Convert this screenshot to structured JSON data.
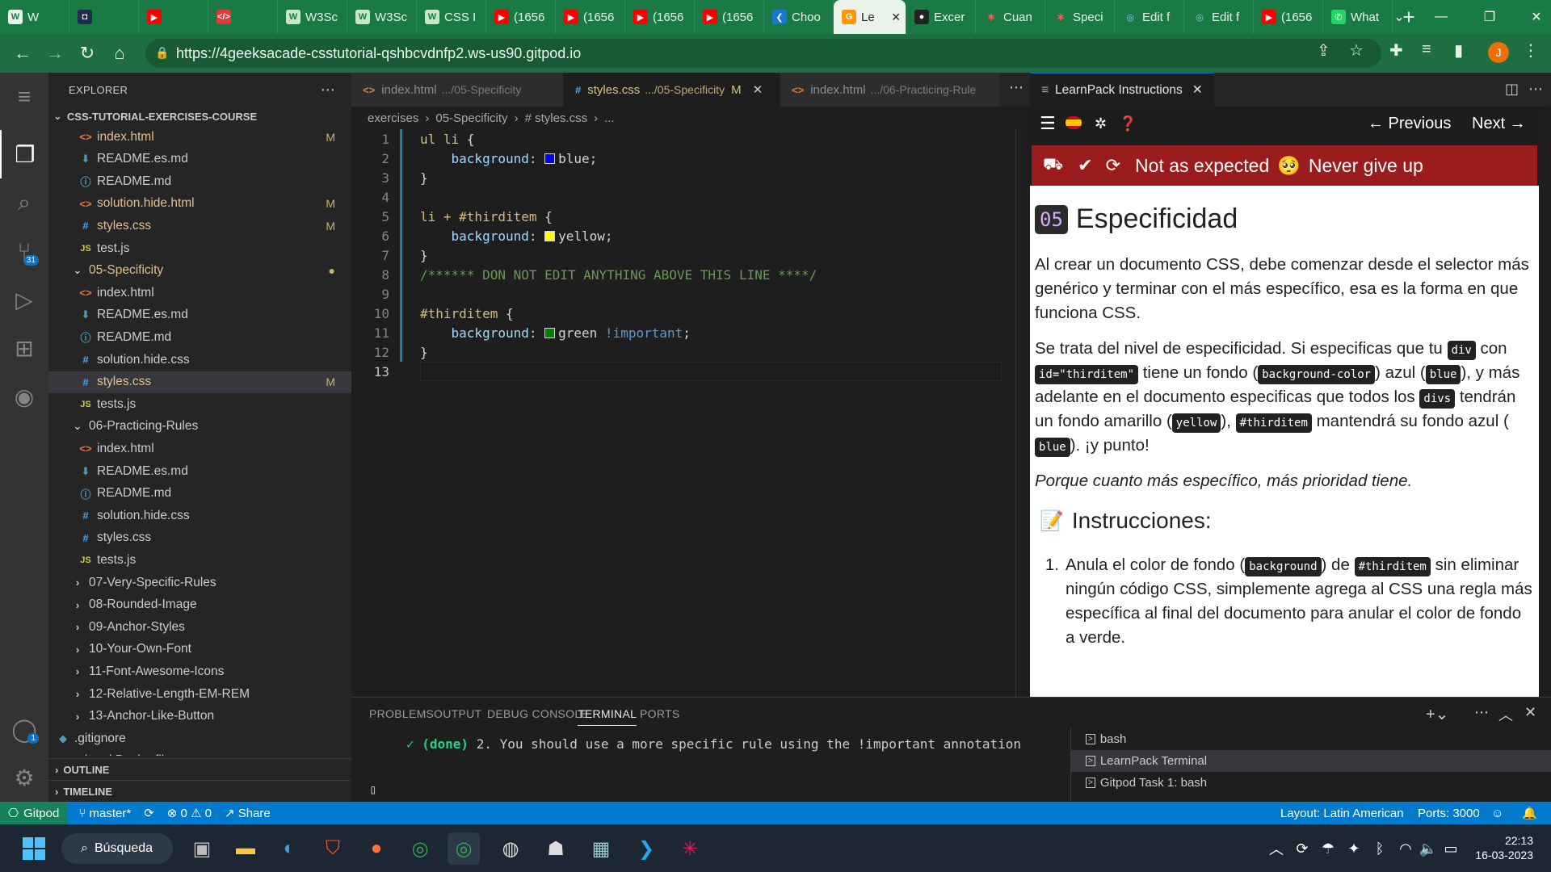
{
  "browser": {
    "tabs": [
      {
        "label": "W",
        "fav": "W",
        "favcolor": "#1a7a45",
        "favbg": "#e6f2ea"
      },
      {
        "label": "",
        "fav": "◘",
        "favcolor": "#fff",
        "favbg": "#1f2d4f"
      },
      {
        "label": "",
        "fav": "▶",
        "favcolor": "#fff",
        "favbg": "#ff0000"
      },
      {
        "label": "",
        "fav": "</>",
        "favcolor": "#fff",
        "favbg": "#e53935"
      },
      {
        "label": "W3Sc",
        "fav": "W",
        "favcolor": "#1a7a45",
        "favbg": "#c8e6c9"
      },
      {
        "label": "W3Sc",
        "fav": "W",
        "favcolor": "#1a7a45",
        "favbg": "#c8e6c9"
      },
      {
        "label": "CSS I",
        "fav": "W",
        "favcolor": "#1a7a45",
        "favbg": "#c8e6c9"
      },
      {
        "label": "(1656",
        "fav": "▶",
        "favcolor": "#fff",
        "favbg": "#ff0000"
      },
      {
        "label": "(1656",
        "fav": "▶",
        "favcolor": "#fff",
        "favbg": "#ff0000"
      },
      {
        "label": "(1656",
        "fav": "▶",
        "favcolor": "#fff",
        "favbg": "#ff0000"
      },
      {
        "label": "(1656",
        "fav": "▶",
        "favcolor": "#fff",
        "favbg": "#ff0000"
      },
      {
        "label": "Choo",
        "fav": "❮",
        "favcolor": "#fff",
        "favbg": "#1976d2"
      },
      {
        "label": "Le",
        "fav": "G",
        "favcolor": "#fff",
        "favbg": "#ff9800",
        "active": true
      },
      {
        "label": "Excer",
        "fav": "●",
        "favcolor": "#fff",
        "favbg": "#222"
      },
      {
        "label": "Cuan",
        "fav": "✱",
        "favcolor": "#ff5252",
        "favbg": "transparent"
      },
      {
        "label": "Speci",
        "fav": "✱",
        "favcolor": "#ff5252",
        "favbg": "transparent"
      },
      {
        "label": "Edit f",
        "fav": "◎",
        "favcolor": "#90caf9",
        "favbg": "transparent"
      },
      {
        "label": "Edit f",
        "fav": "◎",
        "favcolor": "#90caf9",
        "favbg": "transparent"
      },
      {
        "label": "(1656",
        "fav": "▶",
        "favcolor": "#fff",
        "favbg": "#ff0000"
      },
      {
        "label": "What",
        "fav": "✆",
        "favcolor": "#fff",
        "favbg": "#25d366"
      }
    ],
    "new_tab": "+",
    "url": "https://4geeksacade-csstutorial-qshbcvdnfp2.ws-us90.gitpod.io",
    "profile_initial": "J"
  },
  "explorer": {
    "title": "EXPLORER",
    "root": "CSS-TUTORIAL-EXERCISES-COURSE",
    "items": [
      {
        "label": "index.html",
        "type": "html",
        "indent": 1,
        "mark": "M",
        "yellow": true
      },
      {
        "label": "README.es.md",
        "type": "md",
        "indent": 1
      },
      {
        "label": "README.md",
        "type": "info",
        "indent": 1
      },
      {
        "label": "solution.hide.html",
        "type": "html",
        "indent": 1,
        "mark": "M",
        "yellow": true
      },
      {
        "label": "styles.css",
        "type": "css",
        "indent": 1,
        "mark": "M",
        "yellow": true
      },
      {
        "label": "test.js",
        "type": "js",
        "indent": 1
      },
      {
        "label": "05-Specificity",
        "type": "folder-open",
        "indent": 0,
        "mark": "●",
        "yellow": true
      },
      {
        "label": "index.html",
        "type": "html",
        "indent": 1
      },
      {
        "label": "README.es.md",
        "type": "md",
        "indent": 1
      },
      {
        "label": "README.md",
        "type": "info",
        "indent": 1
      },
      {
        "label": "solution.hide.css",
        "type": "css",
        "indent": 1
      },
      {
        "label": "styles.css",
        "type": "css",
        "indent": 1,
        "mark": "M",
        "yellow": true,
        "selected": true
      },
      {
        "label": "tests.js",
        "type": "js",
        "indent": 1
      },
      {
        "label": "06-Practicing-Rules",
        "type": "folder-open",
        "indent": 0
      },
      {
        "label": "index.html",
        "type": "html",
        "indent": 1
      },
      {
        "label": "README.es.md",
        "type": "md",
        "indent": 1
      },
      {
        "label": "README.md",
        "type": "info",
        "indent": 1
      },
      {
        "label": "solution.hide.css",
        "type": "css",
        "indent": 1
      },
      {
        "label": "styles.css",
        "type": "css",
        "indent": 1
      },
      {
        "label": "tests.js",
        "type": "js",
        "indent": 1
      },
      {
        "label": "07-Very-Specific-Rules",
        "type": "folder",
        "indent": 0
      },
      {
        "label": "08-Rounded-Image",
        "type": "folder",
        "indent": 0
      },
      {
        "label": "09-Anchor-Styles",
        "type": "folder",
        "indent": 0
      },
      {
        "label": "10-Your-Own-Font",
        "type": "folder",
        "indent": 0
      },
      {
        "label": "11-Font-Awesome-Icons",
        "type": "folder",
        "indent": 0
      },
      {
        "label": "12-Relative-Length-EM-REM",
        "type": "folder",
        "indent": 0
      },
      {
        "label": "13-Anchor-Like-Button",
        "type": "folder",
        "indent": 0
      },
      {
        "label": ".gitignore",
        "type": "git",
        "indent": -1
      },
      {
        "label": ".gitpod.Dockerfile",
        "type": "docker",
        "indent": -1
      }
    ],
    "outline": "OUTLINE",
    "timeline": "TIMELINE"
  },
  "editor": {
    "tabs": [
      {
        "label": "index.html",
        "path": ".../05-Specificity",
        "icon": "<>"
      },
      {
        "label": "styles.css",
        "path": ".../05-Specificity",
        "icon": "#",
        "active": true,
        "mark": "M"
      },
      {
        "label": "index.html",
        "path": ".../06-Practicing-Rule",
        "icon": "<>"
      }
    ],
    "breadcrumb": [
      "exercises",
      "05-Specificity",
      "# styles.css",
      "..."
    ],
    "lines": [
      [
        {
          "t": "ul li ",
          "c": "sel-tok"
        },
        {
          "t": "{",
          "c": "val-tok"
        }
      ],
      [
        {
          "t": "    background",
          "c": "prop-tok"
        },
        {
          "t": ": ",
          "c": "val-tok"
        },
        {
          "t": "",
          "c": "swatch",
          "color": "#0000ff"
        },
        {
          "t": "blue;",
          "c": "val-tok"
        }
      ],
      [
        {
          "t": "}",
          "c": "val-tok"
        }
      ],
      [],
      [
        {
          "t": "li + #thirditem ",
          "c": "sel-tok"
        },
        {
          "t": "{",
          "c": "val-tok"
        }
      ],
      [
        {
          "t": "    background",
          "c": "prop-tok"
        },
        {
          "t": ": ",
          "c": "val-tok"
        },
        {
          "t": "",
          "c": "swatch",
          "color": "#ffff00"
        },
        {
          "t": "yellow;",
          "c": "val-tok"
        }
      ],
      [
        {
          "t": "}",
          "c": "val-tok"
        }
      ],
      [
        {
          "t": "/****** DON NOT EDIT ANYTHING ABOVE THIS LINE ****/",
          "c": "com-tok"
        }
      ],
      [],
      [
        {
          "t": "#thirditem ",
          "c": "sel-tok"
        },
        {
          "t": "{",
          "c": "val-tok"
        }
      ],
      [
        {
          "t": "    background",
          "c": "prop-tok"
        },
        {
          "t": ": ",
          "c": "val-tok"
        },
        {
          "t": "",
          "c": "swatch",
          "color": "#008000"
        },
        {
          "t": "green ",
          "c": "val-tok"
        },
        {
          "t": "!important",
          "c": "imp-tok"
        },
        {
          "t": ";",
          "c": "val-tok"
        }
      ],
      [
        {
          "t": "}",
          "c": "val-tok"
        }
      ],
      []
    ]
  },
  "panel": {
    "tabs": [
      "PROBLEMS",
      "OUTPUT",
      "DEBUG CONSOLE",
      "TERMINAL",
      "PORTS"
    ],
    "active_tab": "TERMINAL",
    "output_done": "✓ (done)",
    "output_text": "2. You should use a more specific rule using the !important annotation",
    "cursor": "▯",
    "terminals": [
      "bash",
      "LearnPack Terminal",
      "Gitpod Task 1: bash"
    ]
  },
  "learnpack": {
    "tab_title": "LearnPack Instructions",
    "prev": "← Previous",
    "next": "Next →",
    "status_text": "Not as expected",
    "status_emoji": "🥺",
    "status_tail": "Never give up",
    "step": "05",
    "title": "Especificidad",
    "p1": "Al crear un documento CSS, debe comenzar desde el selector más genérico y terminar con el más específico, esa es la forma en que funciona CSS.",
    "p2": {
      "a": "Se trata del nivel de especificidad. Si especificas que tu",
      "k1": "div",
      "b": "con",
      "k2": "id=\"thirditem\"",
      "c": "tiene un fondo (",
      "k3": "background-color",
      "d": ") azul (",
      "k4": "blue",
      "e": "), y más adelante en el documento especificas que todos los",
      "k5": "divs",
      "f": "tendrán un fondo amarillo (",
      "k6": "yellow",
      "g": "),",
      "k7": "#thirditem",
      "h": "mantendrá su fondo azul (",
      "k8": "blue",
      "i": "). ¡y punto!"
    },
    "p3": "Porque cuanto más específico, más prioridad tiene.",
    "instructions_icon": "📝",
    "instructions_title": "Instrucciones:",
    "li1": {
      "a": "Anula el color de fondo (",
      "k1": "background",
      "b": ") de",
      "k2": "#thirditem",
      "c": "sin eliminar ningún código CSS, simplemente agrega al CSS una regla más específica al final del documento para anular el color de fondo a verde."
    }
  },
  "statusbar": {
    "gitpod": "Gitpod",
    "branch": "master*",
    "errors": "⊗ 0",
    "warnings": "⚠ 0",
    "share": "Share",
    "layout": "Layout: Latin American",
    "ports": "Ports: 3000"
  },
  "taskbar": {
    "search": "Búsqueda",
    "time": "22:13",
    "date": "16-03-2023"
  },
  "colors": {
    "chrome_green": "#1a7a45",
    "vscode_blue": "#007acc",
    "learnpack_red": "#9b1c1c"
  }
}
